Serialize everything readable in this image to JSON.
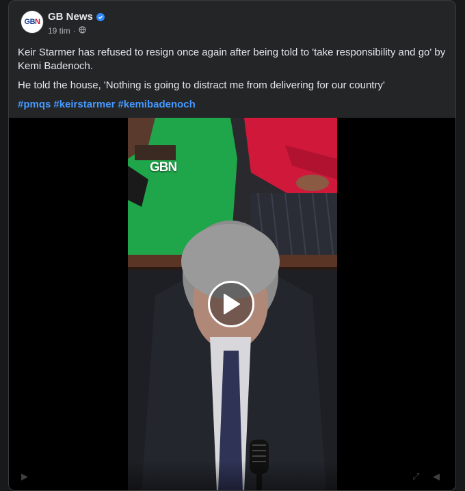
{
  "post": {
    "page_name": "GB News",
    "verified_icon": "verified-badge-icon",
    "time": "19 tim",
    "separator": "·",
    "privacy_icon": "globe-icon",
    "avatar_text_a": "GB",
    "avatar_text_b": "N",
    "paragraphs": [
      "Keir Starmer has refused to resign once again after being told to 'take responsibility and go' by Kemi Badenoch.",
      "He told the house, 'Nothing is going to distract me from delivering for our country'"
    ],
    "hashtags": [
      "#pmqs",
      "#keirstarmer",
      "#kemibadenoch"
    ]
  },
  "video": {
    "watermark_a": "GB",
    "watermark_b": "N",
    "play_icon": "play-icon"
  },
  "colors": {
    "card_bg": "#242526",
    "text": "#e4e6eb",
    "muted": "#b0b3b8",
    "link": "#4599ff",
    "verified": "#2d88ff"
  }
}
